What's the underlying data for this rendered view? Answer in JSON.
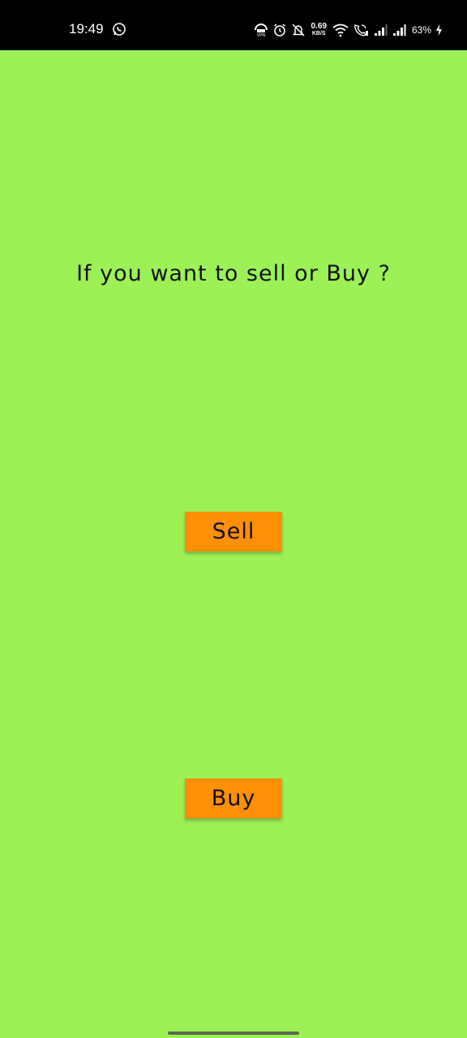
{
  "status_bar": {
    "time": "19:49",
    "net_speed_value": "0.69",
    "net_speed_unit": "KB/S",
    "battery": "63%",
    "icons": [
      "whatsapp-icon",
      "vpn-icon",
      "alarm-icon",
      "mute-icon",
      "wifi-icon",
      "wifi-call-icon",
      "signal-icon",
      "signal-icon",
      "charging-icon"
    ]
  },
  "main": {
    "question": "If you want to sell or Buy ?",
    "sell_label": "Sell",
    "buy_label": "Buy"
  },
  "colors": {
    "background": "#9df157",
    "button": "#fe9008",
    "status_bar": "#000000"
  }
}
